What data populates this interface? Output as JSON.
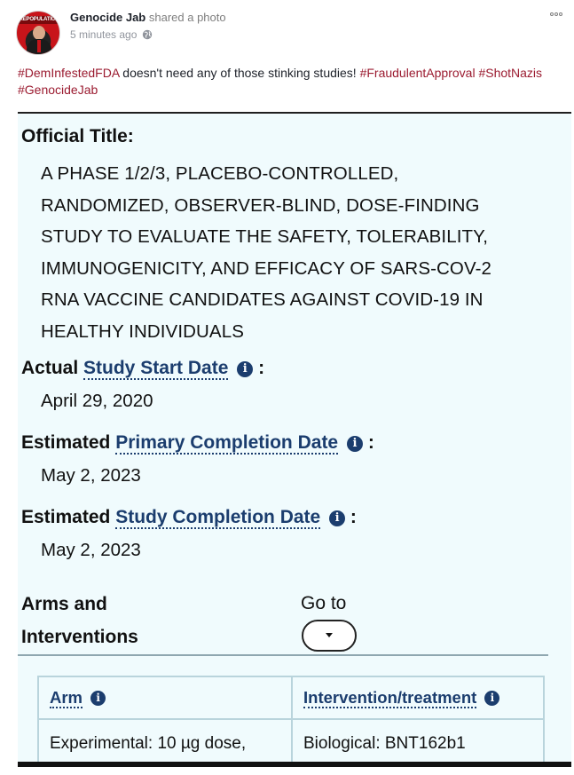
{
  "post": {
    "author": "Genocide Jab",
    "action": "shared a photo",
    "timestamp": "5 minutes ago",
    "avatar_banner": "REPOPULATION",
    "caption_text": " doesn't need any of those stinking studies! ",
    "hashtags": [
      "#DemInfestedFDA",
      "#FraudulentApproval",
      "#ShotNazis",
      "#GenocideJab"
    ],
    "colors": {
      "hashtag": "#9b1b30",
      "link_term": "#1b3d6e",
      "photo_bg": "#f0fbfd"
    }
  },
  "photo": {
    "official_title_label": "Official Title:",
    "official_title_lines": [
      "A PHASE 1/2/3, PLACEBO-CONTROLLED,",
      "RANDOMIZED, OBSERVER-BLIND, DOSE-FINDING",
      "STUDY TO EVALUATE THE SAFETY, TOLERABILITY,",
      "IMMUNOGENICITY, AND EFFICACY OF SARS-COV-2",
      "RNA VACCINE CANDIDATES AGAINST COVID-19 IN",
      "HEALTHY INDIVIDUALS"
    ],
    "start": {
      "prefix": "Actual",
      "term": "Study Start Date",
      "value": "April 29, 2020"
    },
    "primary": {
      "prefix": "Estimated",
      "term": "Primary Completion Date",
      "value": "May 2, 2023"
    },
    "completion": {
      "prefix": "Estimated",
      "term": "Study Completion Date",
      "value": "May 2, 2023"
    },
    "info_glyph": "i",
    "colon": ":",
    "arms_heading_line1": "Arms and",
    "arms_heading_line2": "Interventions",
    "goto_label": "Go to",
    "table": {
      "headers": [
        "Arm",
        "Intervention/treatment"
      ],
      "rows": [
        [
          "Experimental: 10 µg dose,",
          "Biological: BNT162b1"
        ]
      ]
    }
  }
}
